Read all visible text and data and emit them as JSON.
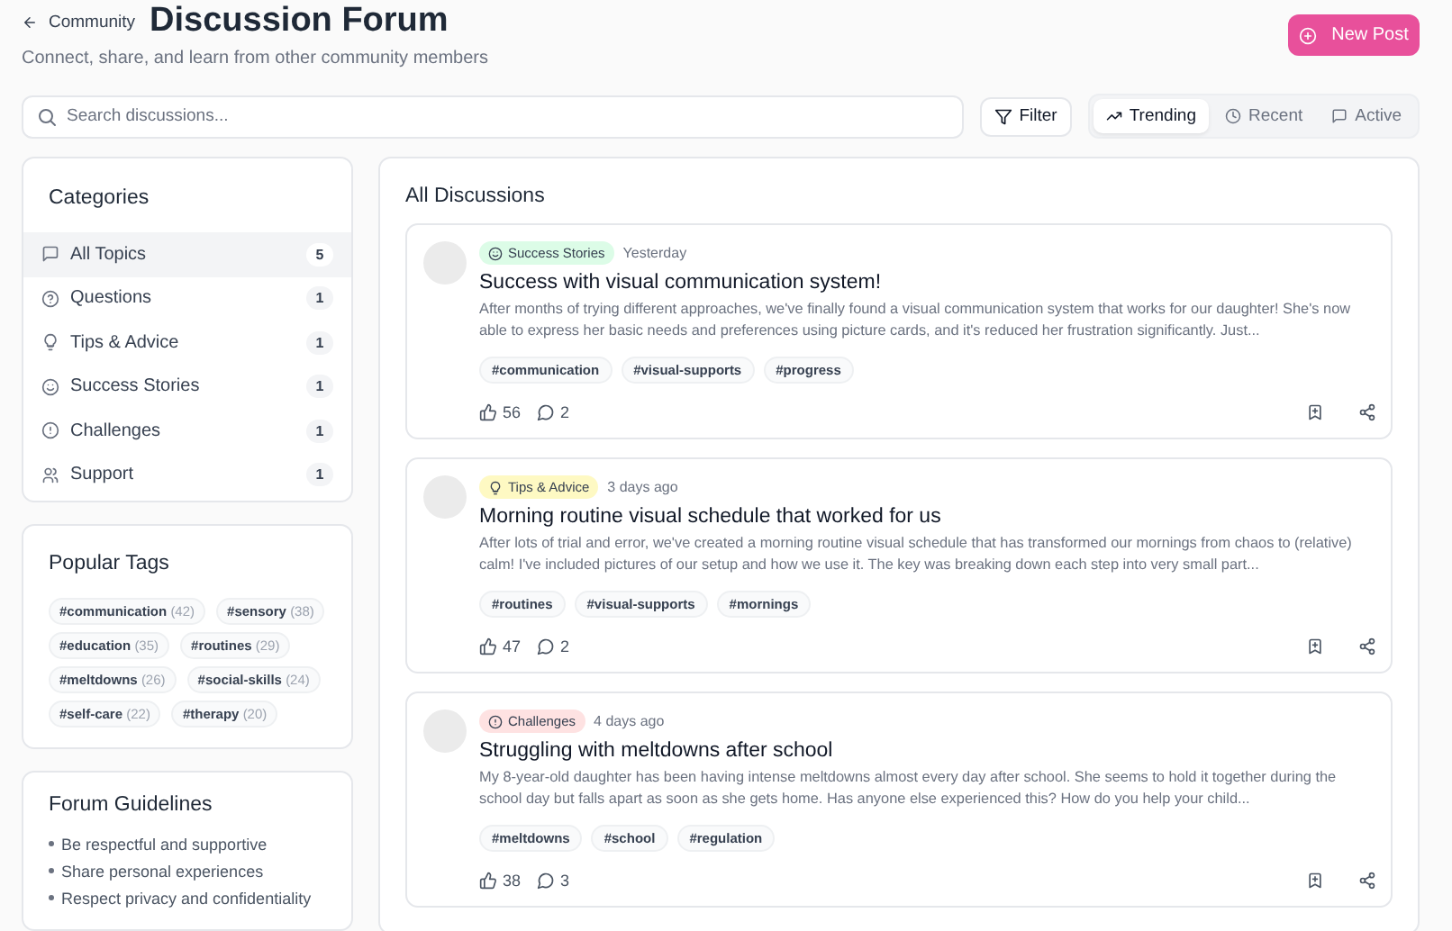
{
  "header": {
    "back_label": "Community",
    "title": "Discussion Forum",
    "subtitle": "Connect, share, and learn from other community members",
    "new_post": "New Post"
  },
  "toolbar": {
    "search_placeholder": "Search discussions...",
    "filter": "Filter",
    "sort_tabs": [
      {
        "label": "Trending",
        "kind": "trend",
        "selected": true
      },
      {
        "label": "Recent",
        "kind": "clock",
        "selected": false
      },
      {
        "label": "Active",
        "kind": "chat",
        "selected": false
      }
    ]
  },
  "categories": {
    "title": "Categories",
    "items": [
      {
        "label": "All Topics",
        "kind": "chat",
        "count": "5",
        "selected": true
      },
      {
        "label": "Questions",
        "kind": "question",
        "count": "1",
        "selected": false
      },
      {
        "label": "Tips & Advice",
        "kind": "bulb",
        "count": "1",
        "selected": false
      },
      {
        "label": "Success Stories",
        "kind": "smile",
        "count": "1",
        "selected": false
      },
      {
        "label": "Challenges",
        "kind": "alert",
        "count": "1",
        "selected": false
      },
      {
        "label": "Support",
        "kind": "users",
        "count": "1",
        "selected": false
      }
    ]
  },
  "popular_tags": {
    "title": "Popular Tags",
    "tags": [
      {
        "name": "#communication",
        "count": "(42)"
      },
      {
        "name": "#sensory",
        "count": "(38)"
      },
      {
        "name": "#education",
        "count": "(35)"
      },
      {
        "name": "#routines",
        "count": "(29)"
      },
      {
        "name": "#meltdowns",
        "count": "(26)"
      },
      {
        "name": "#social-skills",
        "count": "(24)"
      },
      {
        "name": "#self-care",
        "count": "(22)"
      },
      {
        "name": "#therapy",
        "count": "(20)"
      }
    ]
  },
  "guidelines": {
    "title": "Forum Guidelines",
    "items": [
      "Be respectful and supportive",
      "Share personal experiences",
      "Respect privacy and confidentiality"
    ]
  },
  "discussions": {
    "title": "All Discussions",
    "posts": [
      {
        "category": {
          "label": "Success Stories",
          "kind": "smile",
          "color": "#dcfce7"
        },
        "time": "Yesterday",
        "title": "Success with visual communication system!",
        "excerpt": "After months of trying different approaches, we've finally found a visual communication system that works for our daughter! She's now able to express her basic needs and preferences using picture cards, and it's reduced her frustration significantly. Just...",
        "tags": [
          "#communication",
          "#visual-supports",
          "#progress"
        ],
        "likes": "56",
        "comments": "2"
      },
      {
        "category": {
          "label": "Tips & Advice",
          "kind": "bulb",
          "color": "#fef9c3"
        },
        "time": "3 days ago",
        "title": "Morning routine visual schedule that worked for us",
        "excerpt": "After lots of trial and error, we've created a morning routine visual schedule that has transformed our mornings from chaos to (relative) calm! I've included pictures of our setup and how we use it. The key was breaking down each step into very small part...",
        "tags": [
          "#routines",
          "#visual-supports",
          "#mornings"
        ],
        "likes": "47",
        "comments": "2"
      },
      {
        "category": {
          "label": "Challenges",
          "kind": "alert",
          "color": "#fee2e2"
        },
        "time": "4 days ago",
        "title": "Struggling with meltdowns after school",
        "excerpt": "My 8-year-old daughter has been having intense meltdowns almost every day after school. She seems to hold it together during the school day but falls apart as soon as she gets home. Has anyone else experienced this? How do you help your child...",
        "tags": [
          "#meltdowns",
          "#school",
          "#regulation"
        ],
        "likes": "38",
        "comments": "3"
      }
    ]
  }
}
